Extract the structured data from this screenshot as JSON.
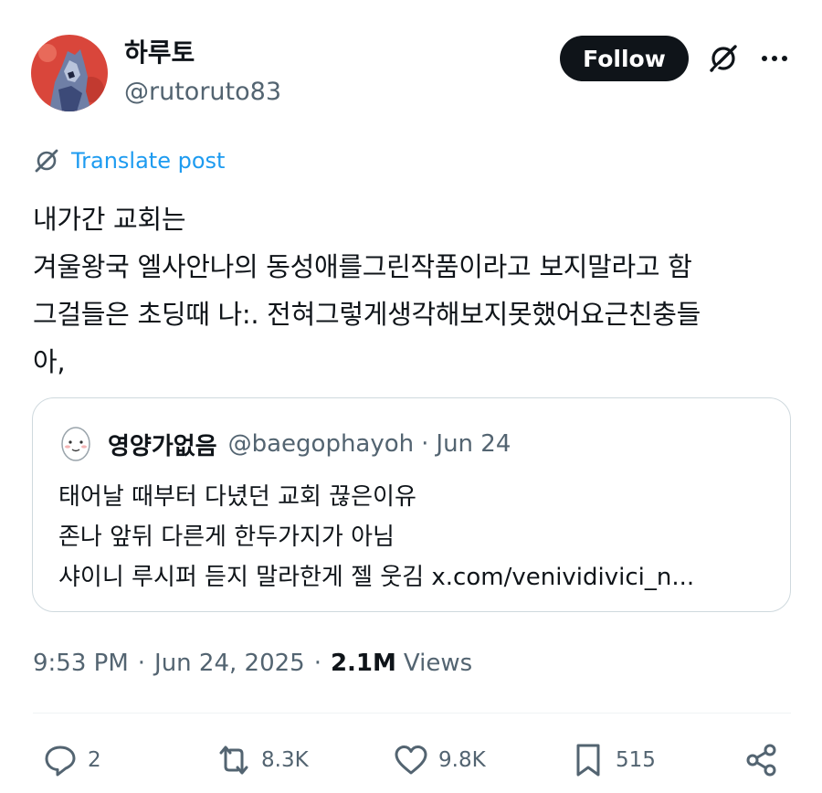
{
  "author": {
    "display_name": "하루토",
    "handle": "@rutoruto83",
    "avatar_icon": "avatar-red-illustration"
  },
  "header": {
    "follow_label": "Follow",
    "grok_icon": "grok-icon",
    "more_icon": "more-icon"
  },
  "translate": {
    "label": "Translate post"
  },
  "post": {
    "lines": [
      "내가간 교회는",
      "겨울왕국 엘사안나의 동성애를그린작품이라고 보지말라고 함",
      "그걸들은 초딩때 나:. 전혀그렇게생각해보지못했어요근친충들",
      "아,"
    ]
  },
  "quote": {
    "display_name": "영양가없음",
    "handle": "@baegophayoh",
    "date": "Jun 24",
    "dot": "·",
    "lines": [
      "태어날 때부터 다녔던 교회 끊은이유",
      "존나 앞뒤 다른게 한두가지가 아님",
      "샤이니 루시퍼 듣지 말라한게 젤 웃김 x.com/venividivici_n..."
    ]
  },
  "meta": {
    "time": "9:53 PM",
    "dot": "·",
    "date": "Jun 24, 2025",
    "views_count": "2.1M",
    "views_label": "Views"
  },
  "actions": {
    "replies": "2",
    "reposts": "8.3K",
    "likes": "9.8K",
    "bookmarks": "515"
  },
  "colors": {
    "accent": "#1d9bf0",
    "text": "#0f1419",
    "secondary": "#536471",
    "border": "#cfd9de",
    "avatar_bg": "#d9463b"
  }
}
